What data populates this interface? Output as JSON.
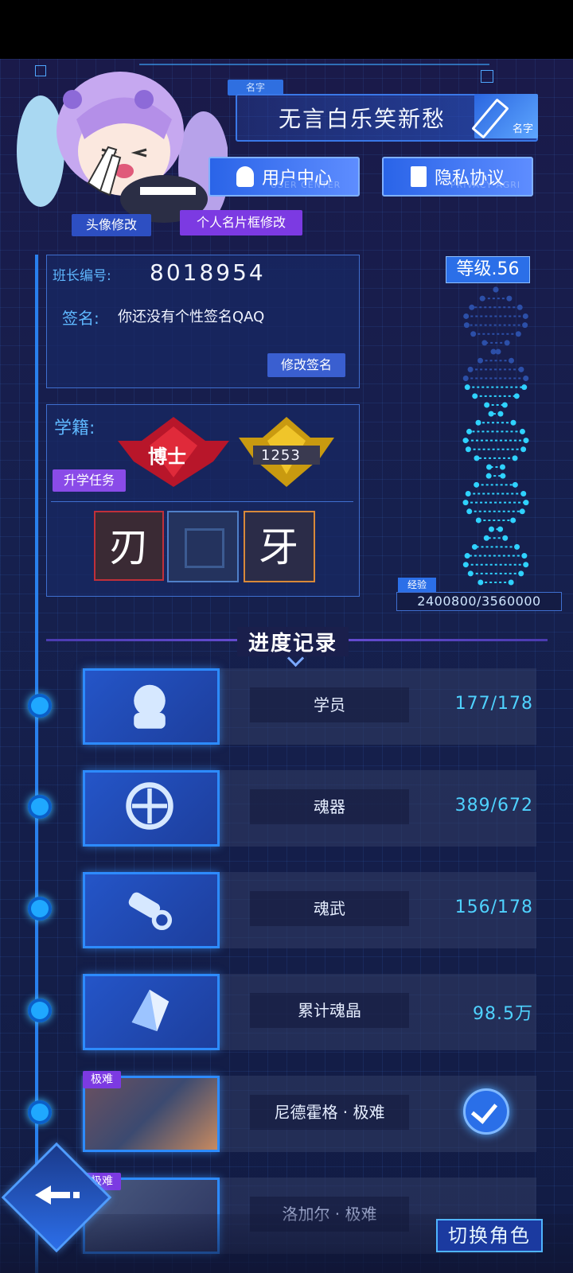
{
  "profile": {
    "name_tag": "名字",
    "nickname": "无言白乐笑新愁",
    "edit_label": "名字",
    "avatar_edit": "头像修改",
    "card_frame_edit": "个人名片框修改"
  },
  "buttons": {
    "user_center": "用户中心",
    "user_center_en": "USER CENTER",
    "privacy": "隐私协议",
    "privacy_en": "PRIVACY AGRI"
  },
  "info": {
    "id_label": "班长编号:",
    "id_value": "8018954",
    "sign_label": "签名:",
    "sign_value": "你还没有个性签名QAQ",
    "edit_sign": "修改签名"
  },
  "school": {
    "label": "学籍:",
    "degree": "博士",
    "rank_value": "1253",
    "promote_task": "升学任务",
    "slot1": "刃",
    "slot3": "牙"
  },
  "level": {
    "label": "等级.56",
    "exp_label": "经验",
    "exp_value": "2400800/3560000",
    "exp_fraction": 0.674
  },
  "progress": {
    "title": "进度记录",
    "rows": [
      {
        "label": "学员",
        "value": "177/178"
      },
      {
        "label": "魂器",
        "value": "389/672"
      },
      {
        "label": "魂武",
        "value": "156/178"
      },
      {
        "label": "累计魂晶",
        "value": "98.5万"
      },
      {
        "label": "尼德霍格 · 极难",
        "tag": "极难"
      },
      {
        "label": "洛加尔 · 极难",
        "tag": "极难"
      }
    ]
  },
  "footer": {
    "switch_role": "切换角色"
  },
  "colors": {
    "accent": "#2d8bff",
    "cyan": "#4fd2ff",
    "purple": "#7c3ae2",
    "red": "#e02a3a",
    "gold": "#f0c52a"
  }
}
